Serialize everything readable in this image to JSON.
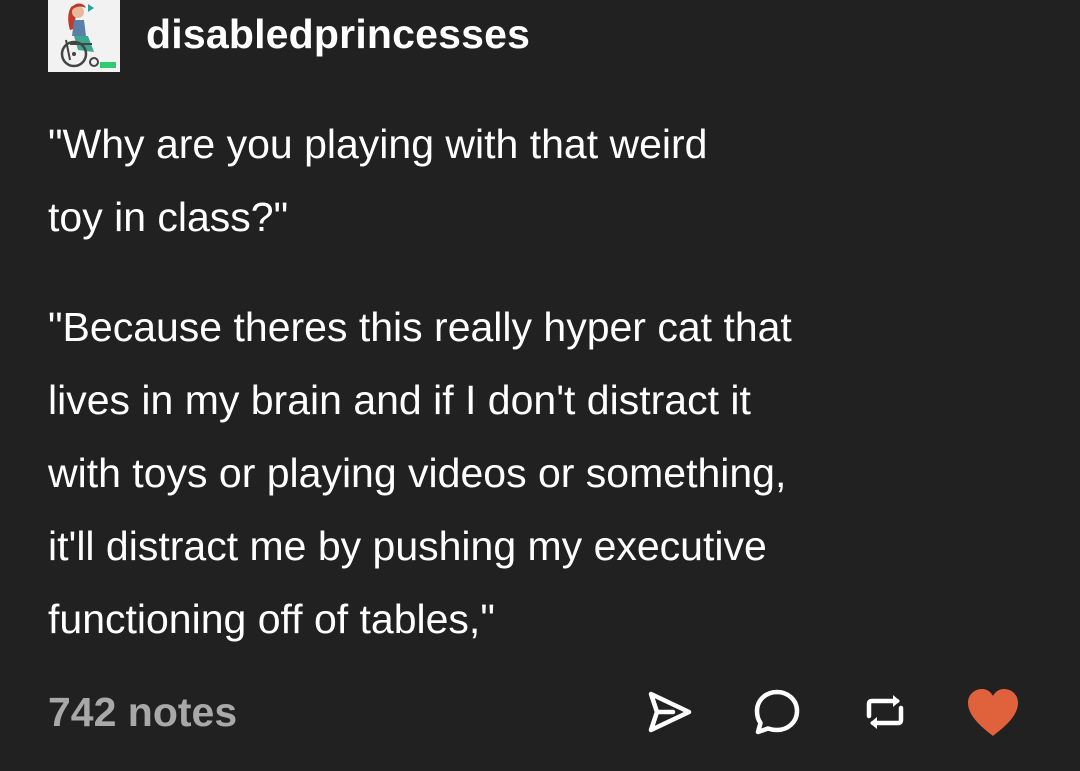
{
  "blog": {
    "name": "disabledprincesses",
    "avatar_icon": "wheelchair-princess-avatar"
  },
  "post": {
    "paragraphs": [
      "\"Why are you playing with that weird\ntoy in class?\"",
      "\"Because theres this really hyper cat that\nlives in my brain and if I don't distract it\nwith toys or playing videos or something,\nit'll distract me by pushing my executive\nfunctioning off of tables,\""
    ]
  },
  "footer": {
    "notes": "742 notes",
    "actions": [
      {
        "icon": "share-icon"
      },
      {
        "icon": "reply-icon"
      },
      {
        "icon": "reblog-icon"
      },
      {
        "icon": "like-icon",
        "active": true
      }
    ]
  },
  "colors": {
    "background": "#212121",
    "text": "#ffffff",
    "muted": "#a8a8a8",
    "like": "#e0623d"
  }
}
